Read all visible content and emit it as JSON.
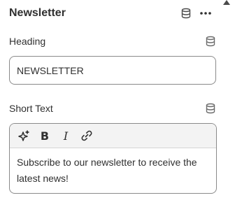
{
  "header": {
    "title": "Newsletter"
  },
  "icons": {
    "database": "database-icon",
    "more": "more-horizontal-icon",
    "scroll_up": "caret-up-icon",
    "magic": "sparkle-icon",
    "bold": "bold-icon",
    "italic": "italic-icon",
    "link": "link-icon"
  },
  "fields": {
    "heading": {
      "label": "Heading",
      "value": "NEWSLETTER"
    },
    "short_text": {
      "label": "Short Text",
      "toolbar": {
        "bold_glyph": "B",
        "italic_glyph": "I"
      },
      "content": "Subscribe to our newsletter to receive the latest news!"
    }
  },
  "colors": {
    "text": "#303030",
    "border": "#8a8a8a",
    "toolbar_bg": "#f3f3f3"
  }
}
